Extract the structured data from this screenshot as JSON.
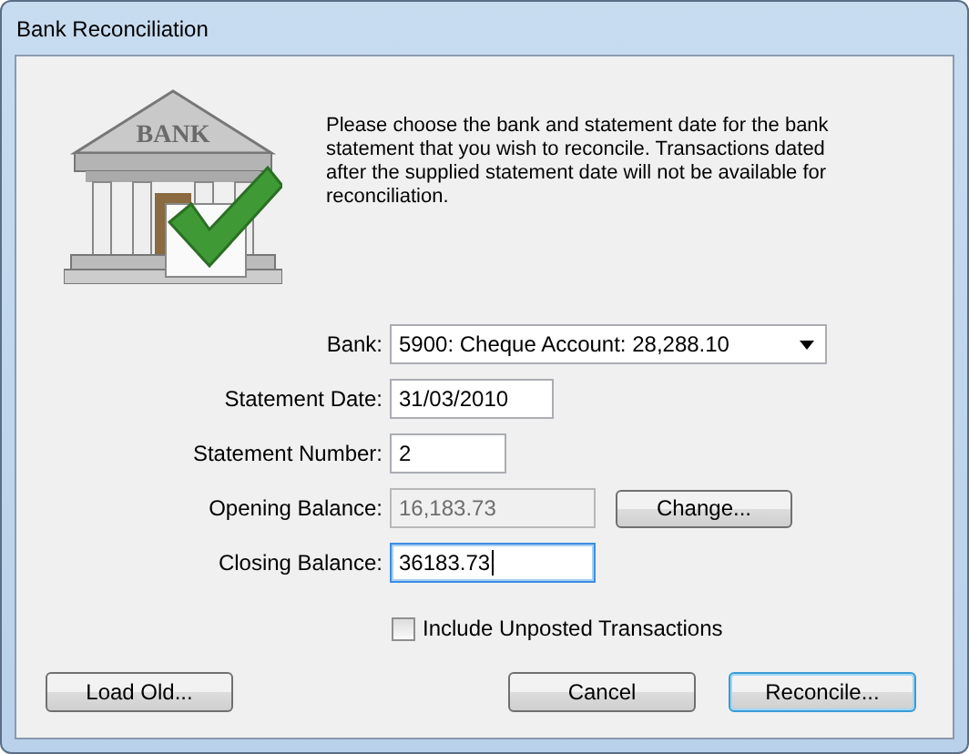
{
  "window": {
    "title": "Bank Reconciliation"
  },
  "icon_text": "BANK",
  "description": "Please choose the bank and statement date for the bank statement that you wish to reconcile.  Transactions dated after the supplied statement date will not be available for reconciliation.",
  "fields": [
    {
      "kind": "dropdown",
      "label": "Bank:",
      "value": "5900: Cheque Account: 28,288.10"
    },
    {
      "kind": "text",
      "label": "Statement Date:",
      "value": "31/03/2010",
      "disabled": false,
      "focused": false
    },
    {
      "kind": "text",
      "label": "Statement Number:",
      "value": "2",
      "disabled": false,
      "focused": false
    },
    {
      "kind": "text",
      "label": "Opening Balance:",
      "value": "16,183.73",
      "disabled": true,
      "focused": false,
      "button": {
        "label": "Change..."
      }
    },
    {
      "kind": "text",
      "label": "Closing Balance:",
      "value": "36183.73",
      "disabled": false,
      "focused": true
    }
  ],
  "checkbox": {
    "label": "Include Unposted Transactions",
    "checked": false
  },
  "buttons": [
    {
      "label": "Load Old...",
      "default": false
    },
    {
      "label": "Cancel",
      "default": false
    },
    {
      "label": "Reconcile...",
      "default": true
    }
  ]
}
